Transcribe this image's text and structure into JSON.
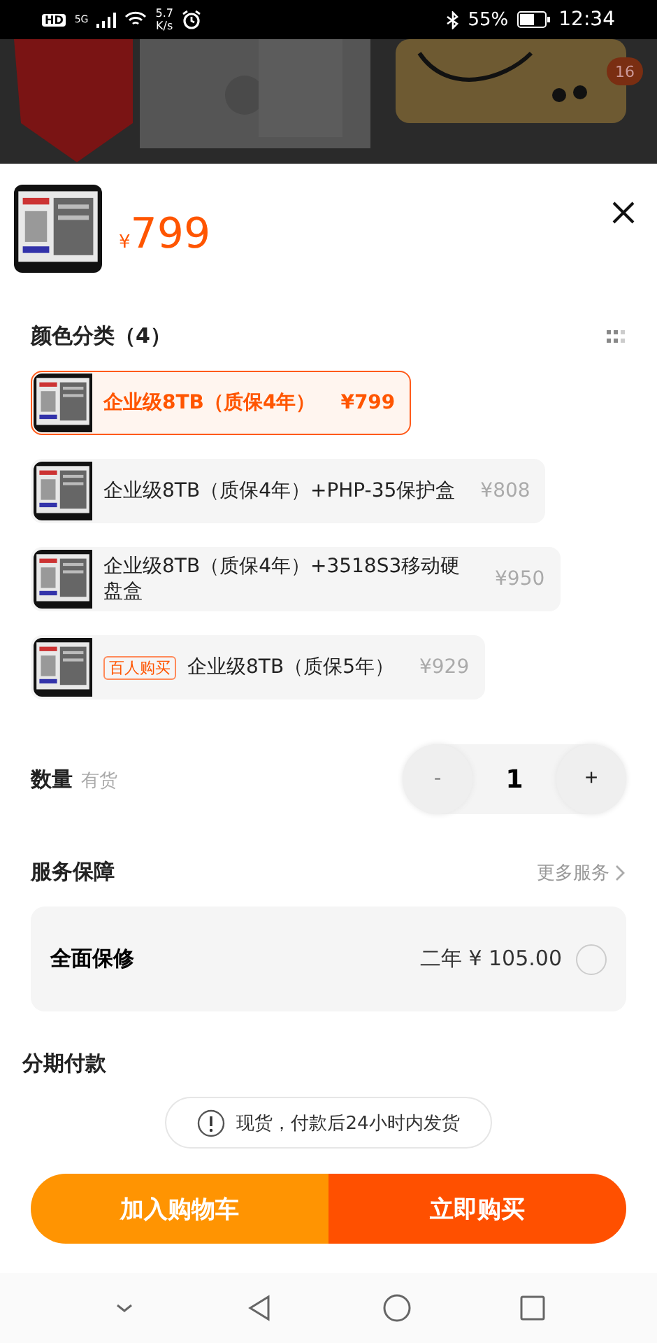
{
  "status_bar": {
    "hd": "HD",
    "network": "5G",
    "speed": "5.7",
    "speed_unit": "K/s",
    "battery": "55%",
    "time": "12:34"
  },
  "background": {
    "cart_badge": "16"
  },
  "product": {
    "currency": "¥",
    "price": "799"
  },
  "variants": {
    "title": "颜色分类（4）",
    "options": [
      {
        "name": "企业级8TB（质保4年）",
        "price": "¥799",
        "selected": true
      },
      {
        "name": "企业级8TB（质保4年）+PHP-35保护盒",
        "price": "¥808",
        "selected": false
      },
      {
        "name": "企业级8TB（质保4年）+3518S3移动硬盘盒",
        "price": "¥950",
        "selected": false
      },
      {
        "tag": "百人购买",
        "name": "企业级8TB（质保5年）",
        "price": "¥929",
        "selected": false
      }
    ]
  },
  "quantity": {
    "label": "数量",
    "stock": "有货",
    "minus": "-",
    "value": "1",
    "plus": "+",
    "minus_disabled": true
  },
  "service": {
    "title": "服务保障",
    "more": "更多服务",
    "item": {
      "name": "全面保修",
      "price": "二年 ¥ 105.00",
      "checked": false
    }
  },
  "installment": {
    "title": "分期付款"
  },
  "notice": "现货，付款后24小时内发货",
  "buttons": {
    "cart": "加入购物车",
    "buy": "立即购买"
  }
}
